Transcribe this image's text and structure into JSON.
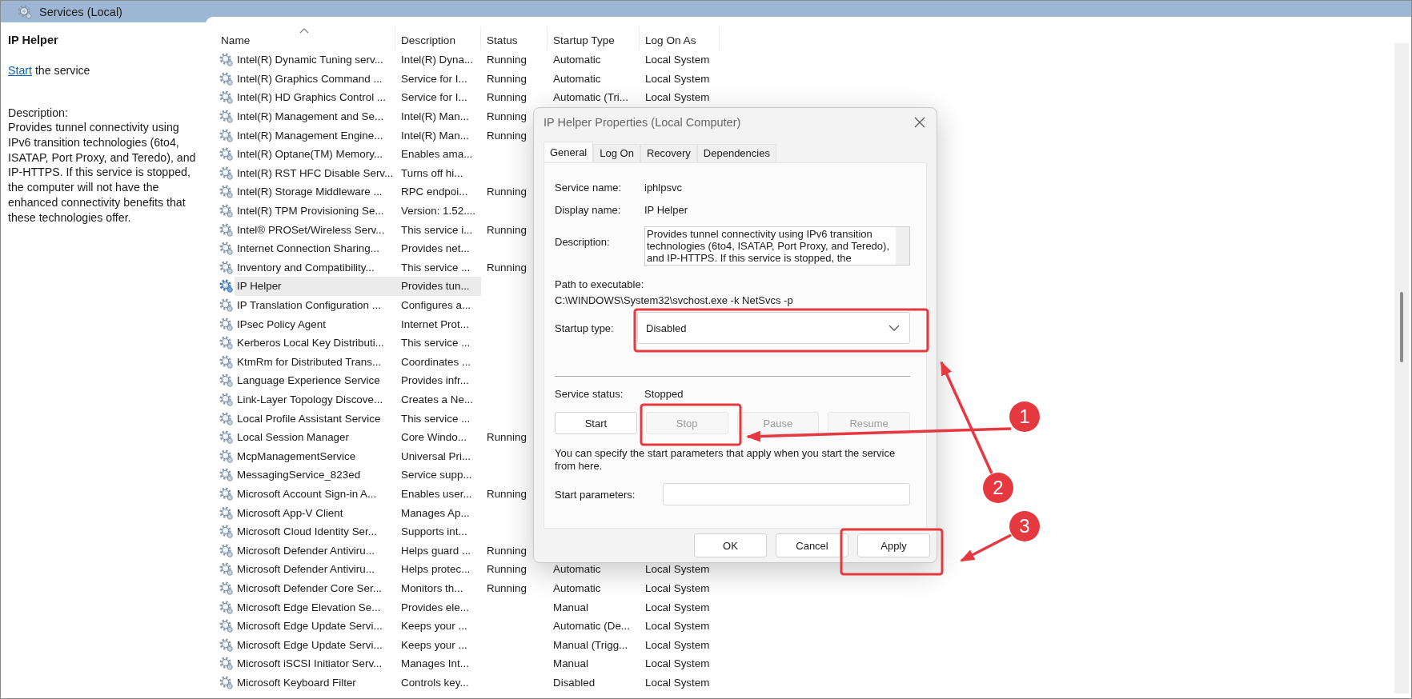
{
  "window": {
    "title": "Services (Local)"
  },
  "detail": {
    "title": "IP Helper",
    "action": {
      "link": "Start",
      "text": "the service"
    },
    "description_label": "Description:",
    "description": "Provides tunnel connectivity using IPv6 transition technologies (6to4, ISATAP, Port Proxy, and Teredo), and IP-HTTPS. If this service is stopped, the computer will not have the enhanced connectivity benefits that these technologies offer."
  },
  "table": {
    "columns": [
      {
        "label": "Name",
        "sorted": true
      },
      {
        "label": "Description",
        "sorted": false
      },
      {
        "label": "Status",
        "sorted": false
      },
      {
        "label": "Startup Type",
        "sorted": false
      },
      {
        "label": "Log On As",
        "sorted": false
      }
    ],
    "rows": [
      {
        "name": "Intel(R) Dynamic Tuning serv...",
        "description": "Intel(R) Dyna...",
        "status": "Running",
        "startup_type": "Automatic",
        "log_on_as": "Local System",
        "selected": false
      },
      {
        "name": "Intel(R) Graphics Command ...",
        "description": "Service for I...",
        "status": "Running",
        "startup_type": "Automatic",
        "log_on_as": "Local System",
        "selected": false
      },
      {
        "name": "Intel(R) HD Graphics Control ...",
        "description": "Service for I...",
        "status": "Running",
        "startup_type": "Automatic (Tri...",
        "log_on_as": "Local System",
        "selected": false
      },
      {
        "name": "Intel(R) Management and Se...",
        "description": "Intel(R) Man...",
        "status": "Running",
        "selected": false
      },
      {
        "name": "Intel(R) Management Engine...",
        "description": "Intel(R) Man...",
        "status": "Running",
        "selected": false
      },
      {
        "name": "Intel(R) Optane(TM) Memory...",
        "description": "Enables ama...",
        "selected": false
      },
      {
        "name": "Intel(R) RST HFC Disable Serv...",
        "description": "Turns off hi...",
        "selected": false
      },
      {
        "name": "Intel(R) Storage Middleware ...",
        "description": "RPC endpoi...",
        "status": "Running",
        "selected": false
      },
      {
        "name": "Intel(R) TPM Provisioning Se...",
        "description": "Version: 1.52....",
        "selected": false
      },
      {
        "name": "Intel® PROSet/Wireless Serv...",
        "description": "This service i...",
        "status": "Running",
        "selected": false
      },
      {
        "name": "Internet Connection Sharing...",
        "description": "Provides net...",
        "selected": false
      },
      {
        "name": "Inventory and Compatibility...",
        "description": "This service ...",
        "status": "Running",
        "selected": false
      },
      {
        "name": "IP Helper",
        "description": "Provides tun...",
        "selected": true
      },
      {
        "name": "IP Translation Configuration ...",
        "description": "Configures a...",
        "selected": false
      },
      {
        "name": "IPsec Policy Agent",
        "description": "Internet Prot...",
        "selected": false
      },
      {
        "name": "Kerberos Local Key Distributi...",
        "description": "This service ...",
        "selected": false
      },
      {
        "name": "KtmRm for Distributed Trans...",
        "description": "Coordinates ...",
        "selected": false
      },
      {
        "name": "Language Experience Service",
        "description": "Provides infr...",
        "selected": false
      },
      {
        "name": "Link-Layer Topology Discove...",
        "description": "Creates a Ne...",
        "selected": false
      },
      {
        "name": "Local Profile Assistant Service",
        "description": "This service ...",
        "selected": false
      },
      {
        "name": "Local Session Manager",
        "description": "Core Windo...",
        "status": "Running",
        "selected": false
      },
      {
        "name": "McpManagementService",
        "description": "Universal Pri...",
        "selected": false
      },
      {
        "name": "MessagingService_823ed",
        "description": "Service supp...",
        "selected": false
      },
      {
        "name": "Microsoft Account Sign-in A...",
        "description": "Enables user...",
        "status": "Running",
        "selected": false
      },
      {
        "name": "Microsoft App-V Client",
        "description": "Manages Ap...",
        "selected": false
      },
      {
        "name": "Microsoft Cloud Identity Ser...",
        "description": "Supports int...",
        "selected": false
      },
      {
        "name": "Microsoft Defender Antiviru...",
        "description": "Helps guard ...",
        "status": "Running",
        "selected": false
      },
      {
        "name": "Microsoft Defender Antiviru...",
        "description": "Helps protec...",
        "status": "Running",
        "startup_type": "Automatic",
        "log_on_as": "Local System",
        "selected": false
      },
      {
        "name": "Microsoft Defender Core Ser...",
        "description": "Monitors th...",
        "status": "Running",
        "startup_type": "Automatic",
        "log_on_as": "Local System",
        "selected": false
      },
      {
        "name": "Microsoft Edge Elevation Se...",
        "description": "Provides ele...",
        "startup_type": "Manual",
        "log_on_as": "Local System",
        "selected": false
      },
      {
        "name": "Microsoft Edge Update Servi...",
        "description": "Keeps your ...",
        "startup_type": "Automatic (De...",
        "log_on_as": "Local System",
        "selected": false
      },
      {
        "name": "Microsoft Edge Update Servi...",
        "description": "Keeps your ...",
        "startup_type": "Manual (Trigg...",
        "log_on_as": "Local System",
        "selected": false
      },
      {
        "name": "Microsoft iSCSI Initiator Serv...",
        "description": "Manages Int...",
        "startup_type": "Manual",
        "log_on_as": "Local System",
        "selected": false
      },
      {
        "name": "Microsoft Keyboard Filter",
        "description": "Controls key...",
        "startup_type": "Disabled",
        "log_on_as": "Local System",
        "selected": false
      }
    ]
  },
  "dialog": {
    "title": "IP Helper Properties (Local Computer)",
    "tabs": [
      {
        "label": "General",
        "selected": true
      },
      {
        "label": "Log On",
        "selected": false
      },
      {
        "label": "Recovery",
        "selected": false
      },
      {
        "label": "Dependencies",
        "selected": false
      }
    ],
    "service_name_label": "Service name:",
    "service_name": "iphlpsvc",
    "display_name_label": "Display name:",
    "display_name": "IP Helper",
    "description_label": "Description:",
    "description": "Provides tunnel connectivity using IPv6 transition technologies (6to4, ISATAP, Port Proxy, and Teredo), and IP-HTTPS. If this service is stopped, the",
    "path_label": "Path to executable:",
    "path": "C:\\WINDOWS\\System32\\svchost.exe -k NetSvcs -p",
    "startup_type_label": "Startup type:",
    "startup_type": "Disabled",
    "service_status_label": "Service status:",
    "service_status": "Stopped",
    "control_buttons": [
      {
        "label": "Start",
        "disabled": false
      },
      {
        "label": "Stop",
        "disabled": true
      },
      {
        "label": "Pause",
        "disabled": true
      },
      {
        "label": "Resume",
        "disabled": true
      }
    ],
    "hint": "You can specify the start parameters that apply when you start the service from here.",
    "start_parameters_label": "Start parameters:",
    "buttons": [
      {
        "label": "OK"
      },
      {
        "label": "Cancel"
      },
      {
        "label": "Apply"
      }
    ]
  },
  "annotations": [
    {
      "number": "1"
    },
    {
      "number": "2"
    },
    {
      "number": "3"
    }
  ]
}
